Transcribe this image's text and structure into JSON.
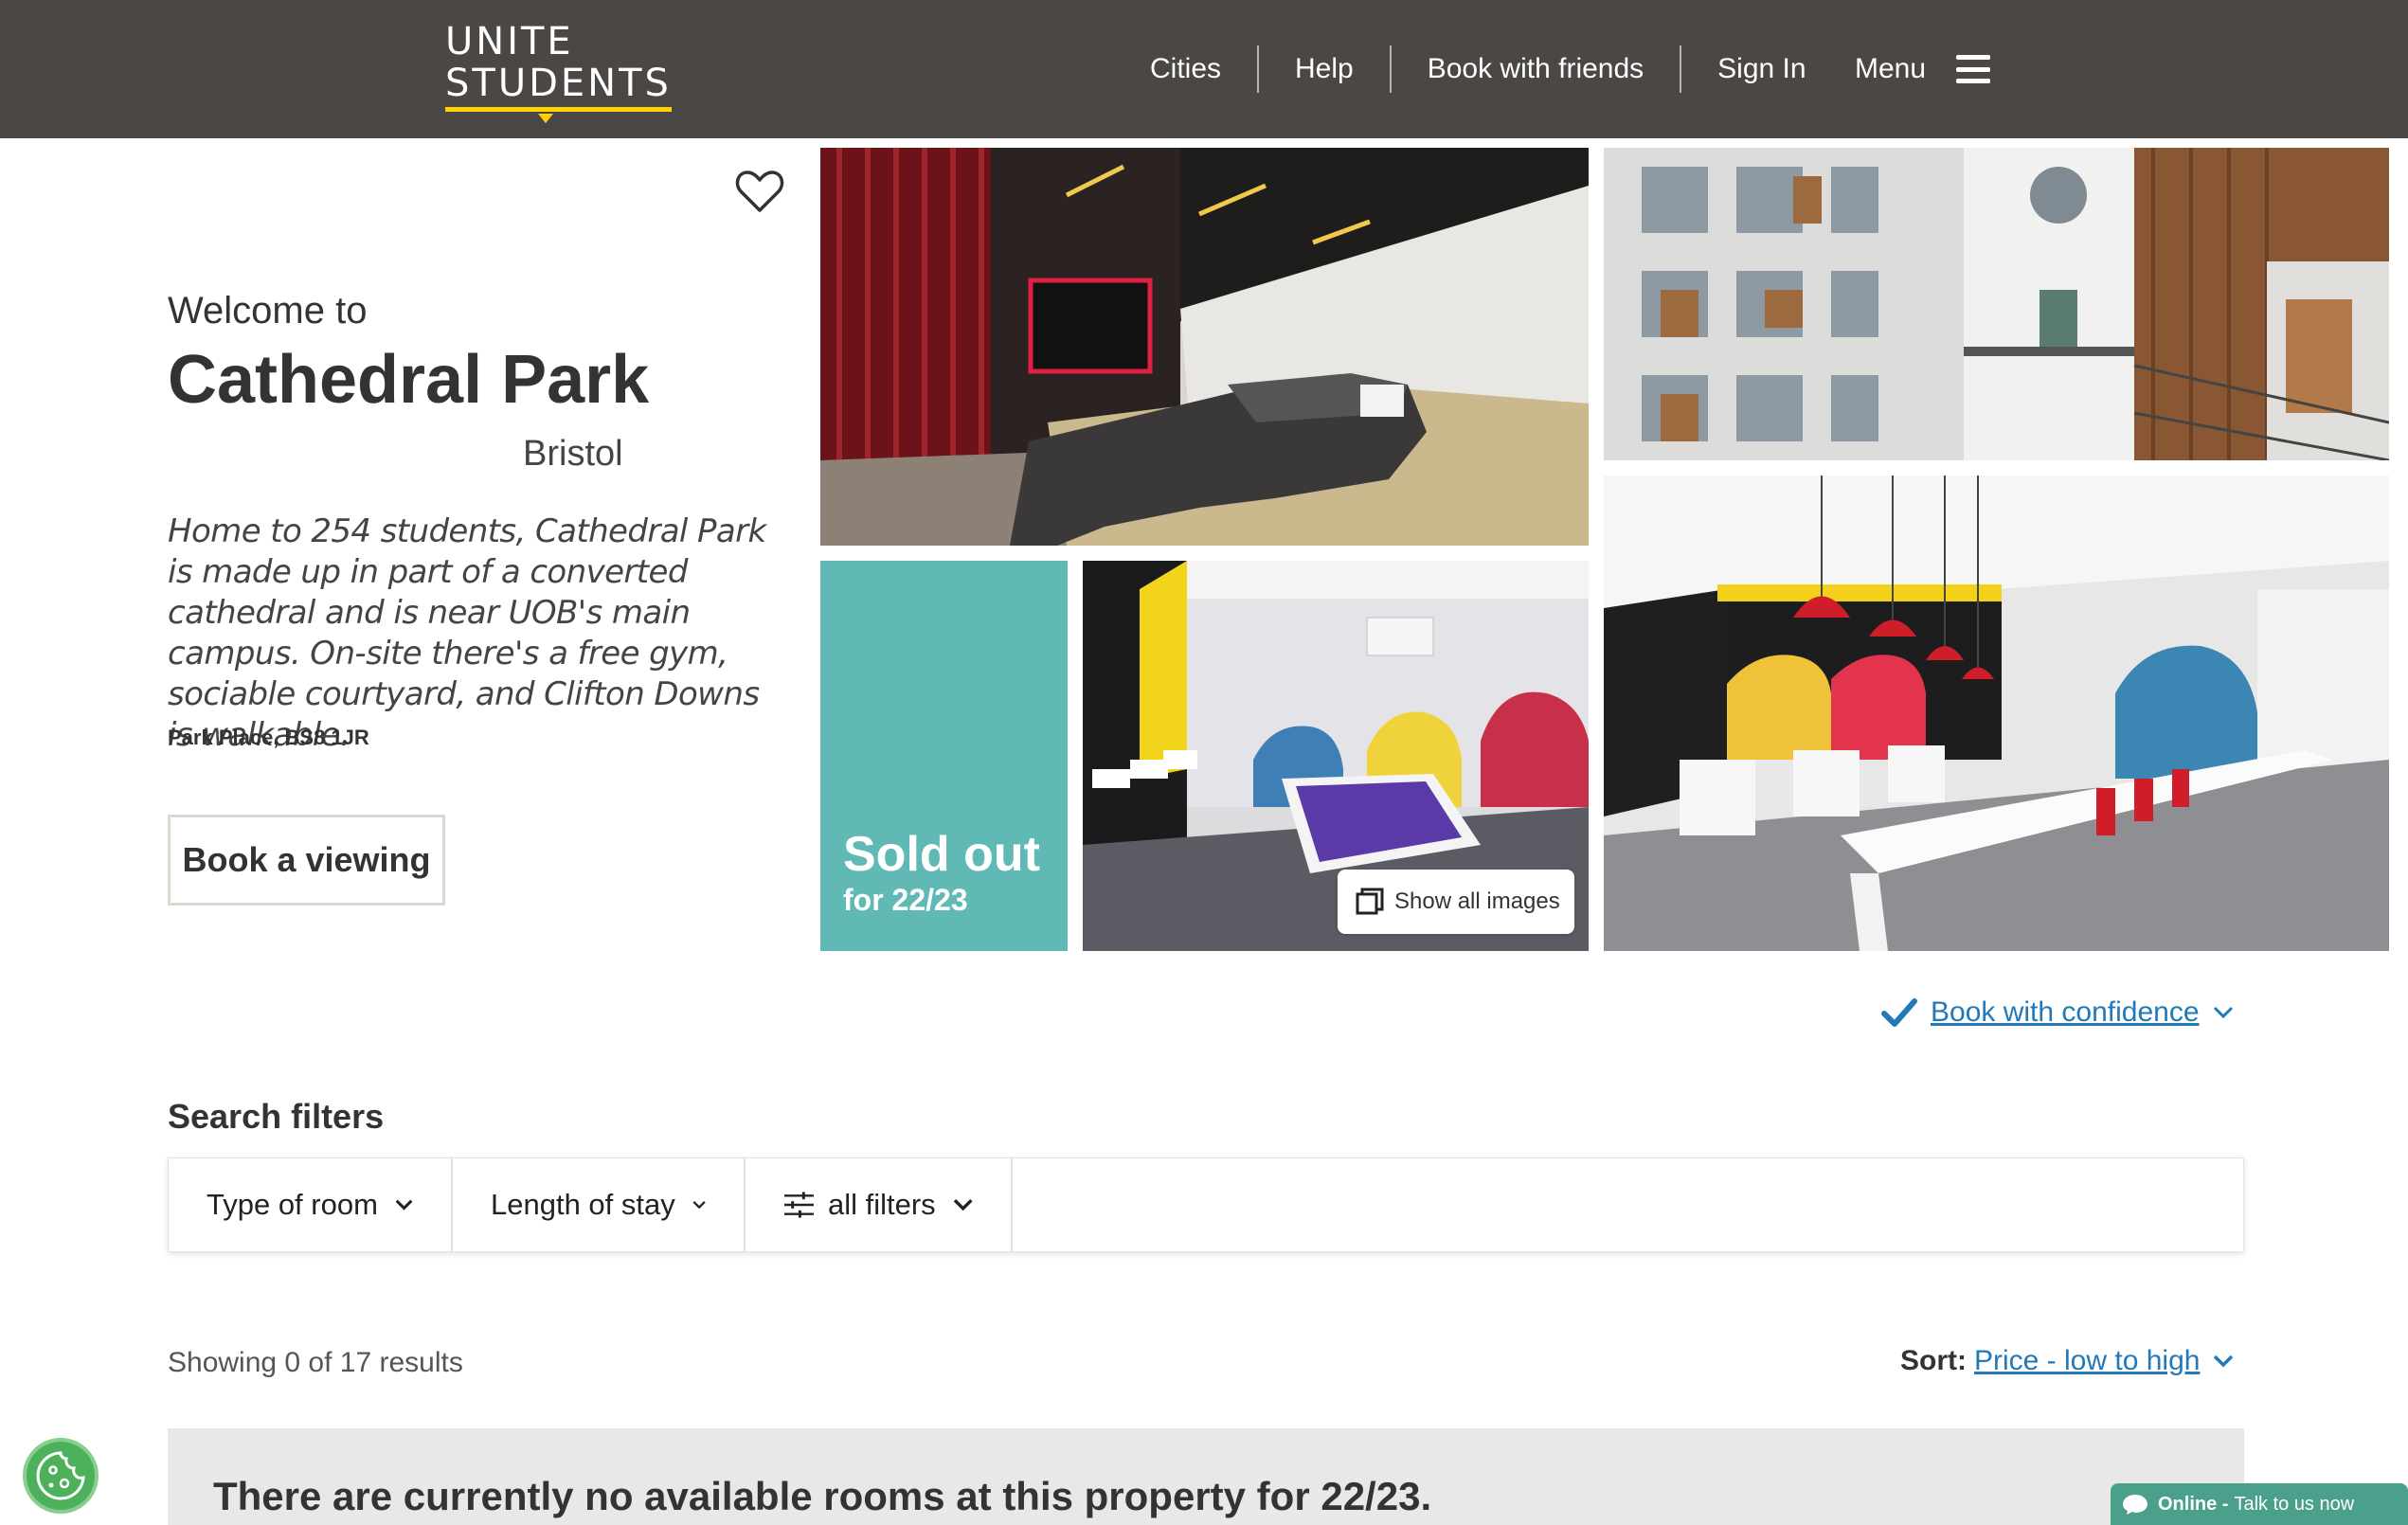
{
  "header": {
    "logo_line1": "UNITE",
    "logo_line2": "STUDENTS",
    "nav": [
      "Cities",
      "Help",
      "Book with friends",
      "Sign In"
    ],
    "menu_label": "Menu"
  },
  "intro": {
    "welcome": "Welcome to",
    "title": "Cathedral Park",
    "city": "Bristol",
    "description": "Home to 254 students, Cathedral Park is made up in part of a converted cathedral and is near UOB's main campus. On-site there's a free gym, sociable courtyard, and Clifton Downs is walkable.",
    "address": "Park Place, BS8 1JR",
    "book_viewing": "Book a viewing"
  },
  "gallery": {
    "sold_out": "Sold out",
    "sold_out_period": "for 22/23",
    "show_all": "Show all images"
  },
  "confidence": {
    "label": "Book with confidence"
  },
  "filters": {
    "title": "Search filters",
    "items": [
      "Type of room",
      "Length of stay",
      "all filters"
    ]
  },
  "results": {
    "count": "Showing 0 of 17 results",
    "sort_label": "Sort:",
    "sort_value": "Price - low to high",
    "no_rooms": "There are currently no available rooms at this property for 22/23."
  },
  "chat": {
    "status": "Online -",
    "cta": "Talk to us now"
  },
  "colors": {
    "header_bg": "#4a4745",
    "accent_yellow": "#ffd200",
    "sold_out_teal": "#61b9b5",
    "link_blue": "#2279b8"
  }
}
